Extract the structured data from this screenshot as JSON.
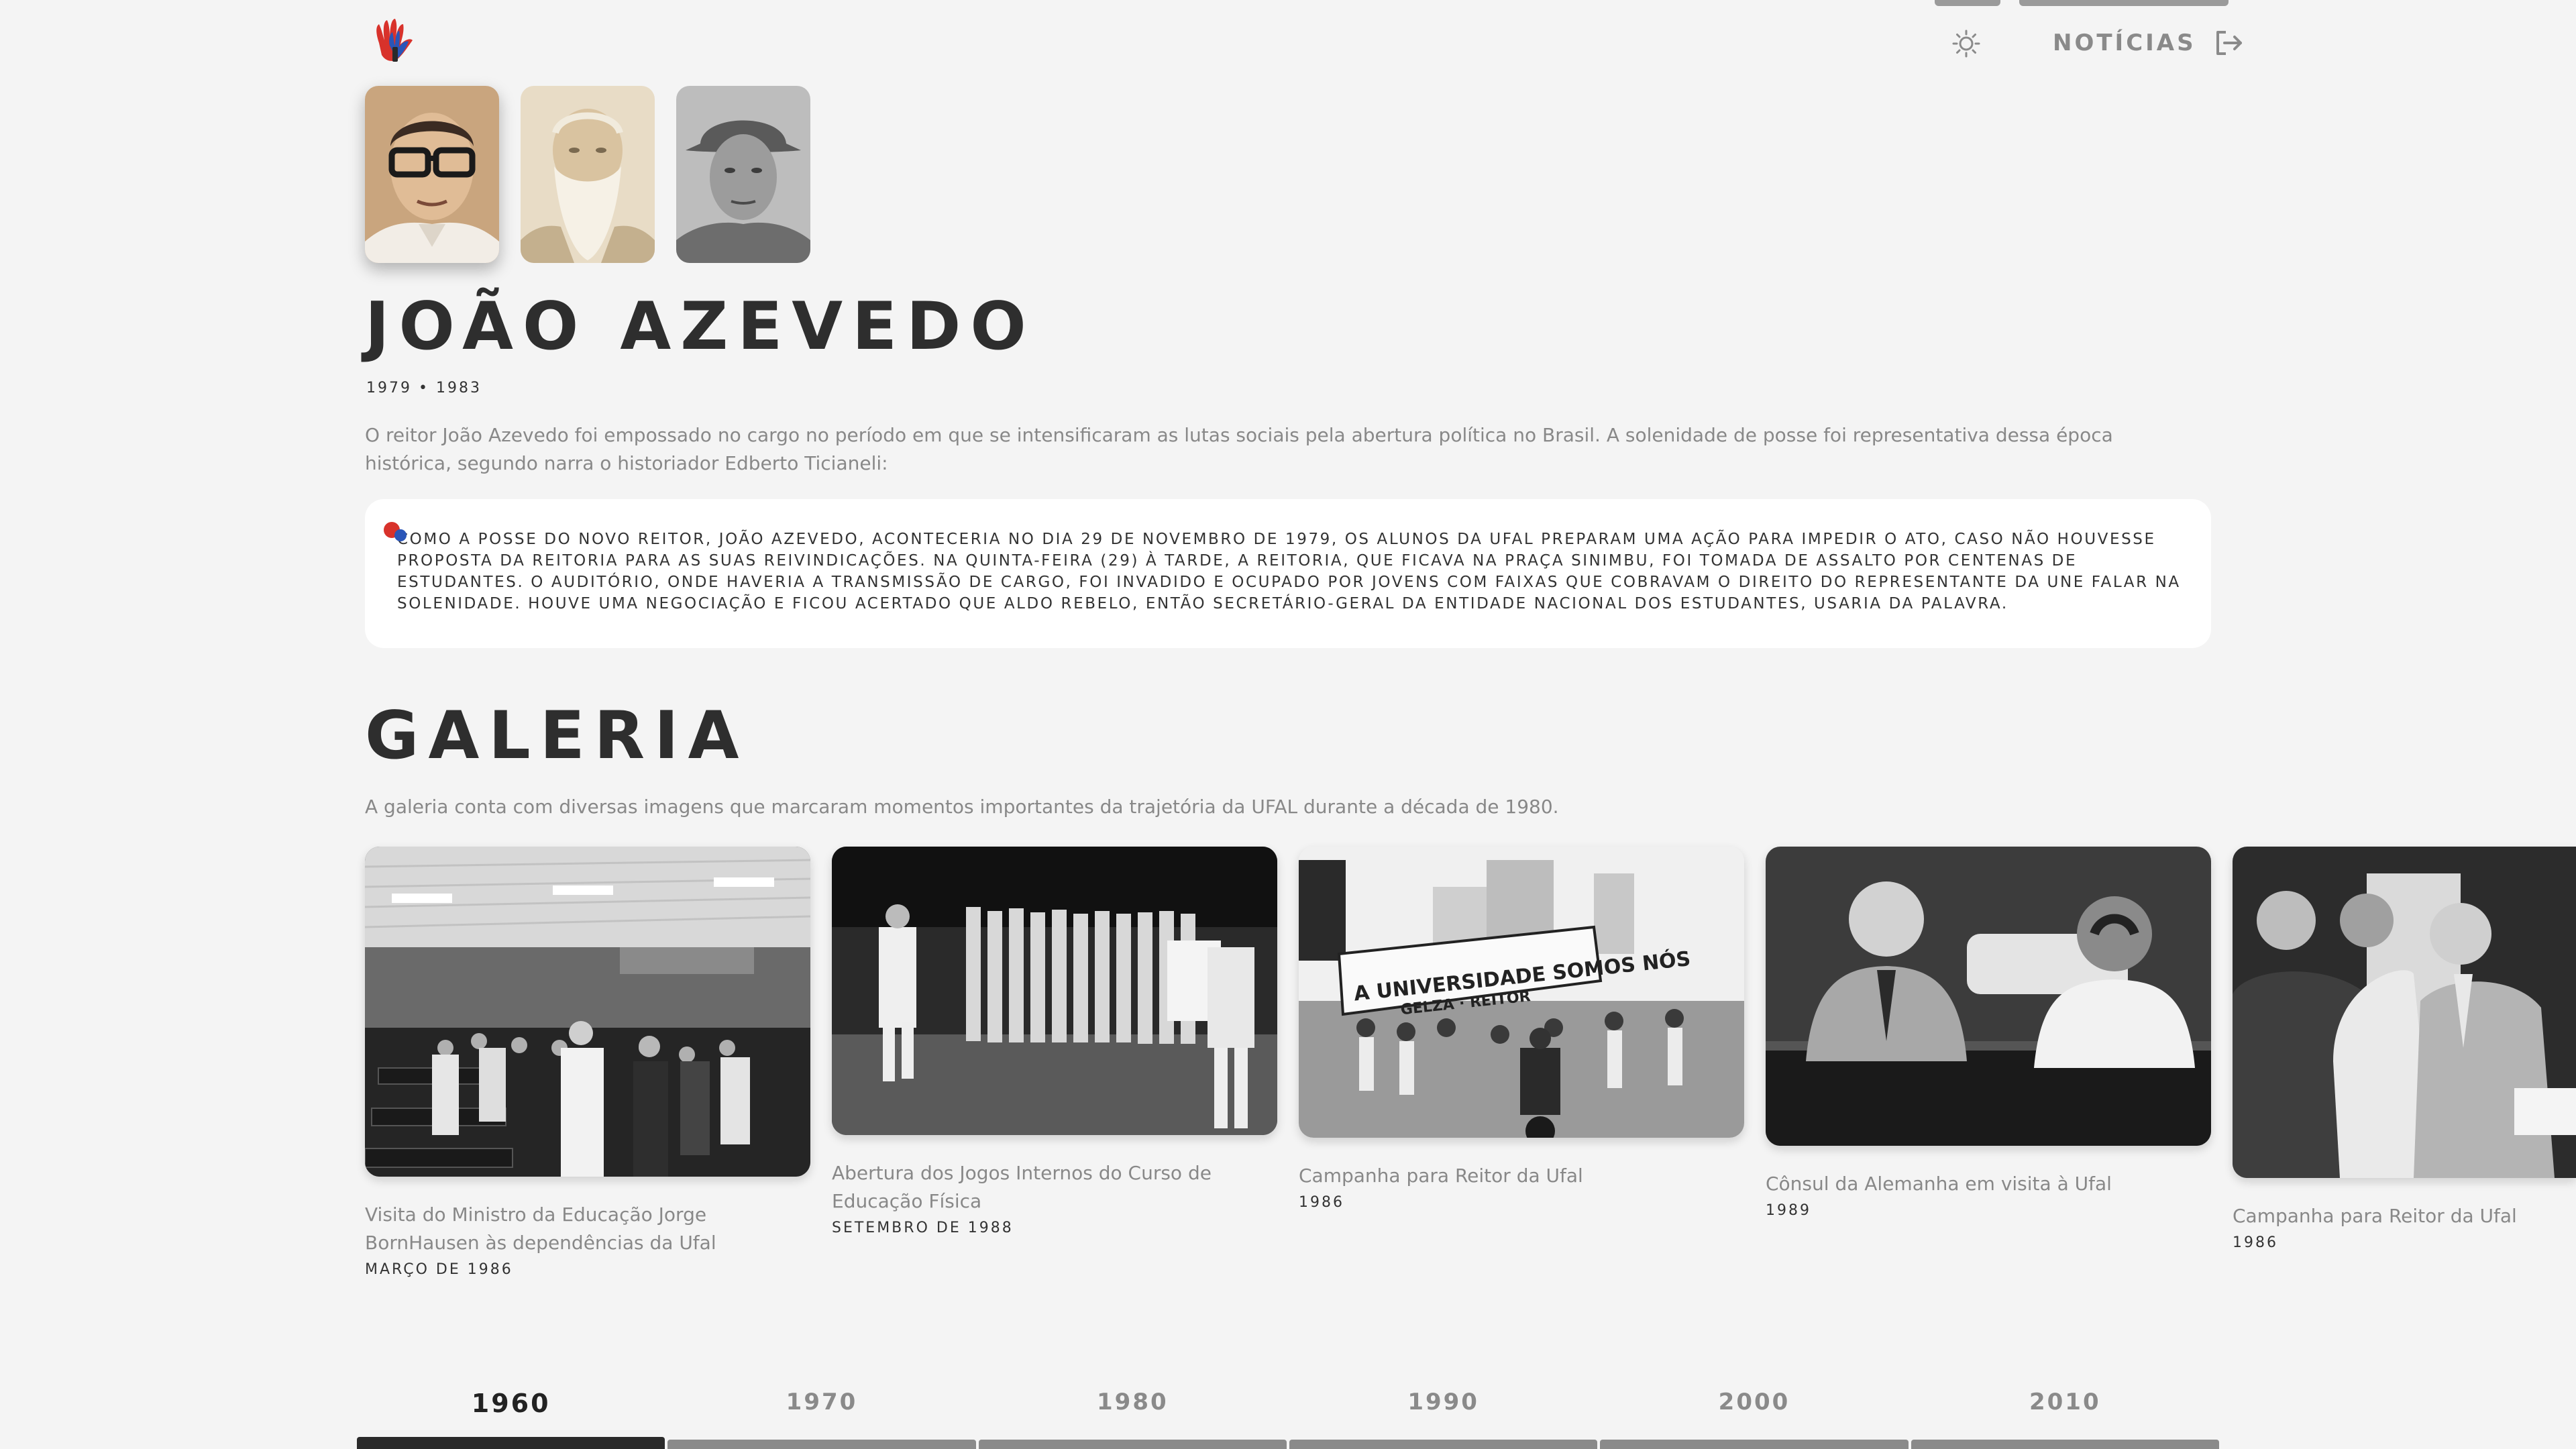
{
  "header": {
    "logo_icon": "ufal-hand-logo",
    "theme_icon": "sun-icon",
    "news_label": "NOTÍCIAS",
    "news_icon": "logout-icon"
  },
  "rector": {
    "name": "JOÃO AZEVEDO",
    "years": "1979  •  1983",
    "intro": "O reitor João Azevedo foi empossado no cargo no período em que se intensificaram as lutas sociais pela abertura política no Brasil. A solenidade de posse foi representativa dessa época histórica, segundo narra o historiador Edberto Ticianeli:",
    "quote": "Como a posse do novo reitor, João Azevedo, aconteceria no dia 29 de novembro de 1979, os alunos da Ufal preparam uma ação para impedir o ato, caso não houvesse proposta da reitoria para as suas reivindicações. Na quinta-feira (29) à tarde, a Reitoria, que ficava na Praça Sinimbu, foi tomada de assalto por centenas de estudantes. O auditório, onde haveria a transmissão de cargo, foi invadido e ocupado por jovens com faixas que cobravam o direito do representante da UNE falar na solenidade. Houve uma negociação e ficou acertado que Aldo Rebelo, então secretário-geral da entidade nacional dos estudantes, usaria da palavra."
  },
  "gallery": {
    "title": "GALERIA",
    "description": "A galeria conta com diversas imagens que marcaram momentos importantes da trajetória da UFAL durante a década de 1980.",
    "items": [
      {
        "caption": "Visita do Ministro da Educação Jorge BornHausen às dependências da Ufal",
        "date": "MARÇO DE 1986"
      },
      {
        "caption": "Abertura dos Jogos Internos do Curso de Educação Física",
        "date": "SETEMBRO DE 1988"
      },
      {
        "caption": "Campanha para Reitor da Ufal",
        "date": "1986",
        "banner": "A UNIVERSIDADE SOMOS NÓS",
        "banner2": "GELZA · REITOR"
      },
      {
        "caption": "Cônsul da Alemanha em visita à Ufal",
        "date": "1989"
      },
      {
        "caption": "Campanha para Reitor da Ufal",
        "date": "1986"
      }
    ]
  },
  "timeline": {
    "decades": [
      "1960",
      "1970",
      "1980",
      "1990",
      "2000",
      "2010"
    ],
    "active": "1960"
  }
}
